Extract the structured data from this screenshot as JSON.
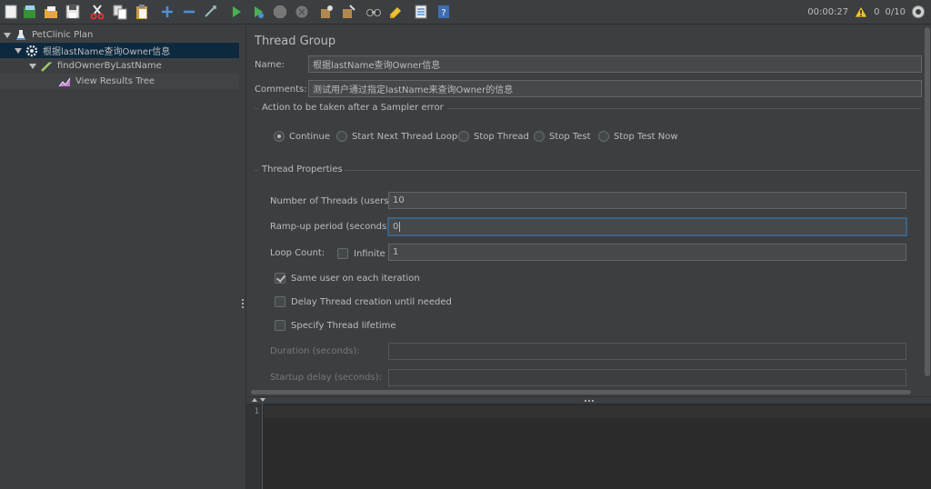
{
  "toolbar": {
    "buttons": [
      {
        "name": "new-icon"
      },
      {
        "name": "templates-icon"
      },
      {
        "name": "open-icon"
      },
      {
        "name": "save-icon"
      },
      {
        "name": "cut-icon"
      },
      {
        "name": "copy-icon"
      },
      {
        "name": "paste-icon"
      },
      {
        "name": "expand-icon"
      },
      {
        "name": "collapse-icon"
      },
      {
        "name": "toggle-icon"
      },
      {
        "name": "start-icon"
      },
      {
        "name": "start-no-pauses-icon"
      },
      {
        "name": "stop-icon"
      },
      {
        "name": "shutdown-icon"
      },
      {
        "name": "clear-icon"
      },
      {
        "name": "clear-all-icon"
      },
      {
        "name": "search-icon"
      },
      {
        "name": "reset-search-icon"
      },
      {
        "name": "function-helper-icon"
      },
      {
        "name": "help-icon"
      }
    ],
    "status": {
      "elapsed": "00:00:27",
      "warnings": "0",
      "threads": "0/10"
    }
  },
  "tree": {
    "items": [
      {
        "label": "PetClinic Plan",
        "level": 0,
        "icon": "test-plan-icon",
        "expanded": true
      },
      {
        "label": "根据lastName查询Owner信息",
        "level": 1,
        "icon": "thread-group-icon",
        "expanded": true,
        "selected": true
      },
      {
        "label": "findOwnerByLastName",
        "level": 2,
        "icon": "http-sampler-icon",
        "expanded": true
      },
      {
        "label": "View Results Tree",
        "level": 3,
        "icon": "listener-icon"
      }
    ]
  },
  "panel": {
    "title": "Thread Group",
    "name_label": "Name:",
    "name_value": "根据lastName查询Owner信息",
    "comments_label": "Comments:",
    "comments_value": "测试用户通过指定lastName来查询Owner的信息",
    "sampler_error": {
      "title": "Action to be taken after a Sampler error",
      "options": [
        "Continue",
        "Start Next Thread Loop",
        "Stop Thread",
        "Stop Test",
        "Stop Test Now"
      ],
      "selected": "Continue"
    },
    "thread_props": {
      "title": "Thread Properties",
      "threads_label": "Number of Threads (users):",
      "threads_value": "10",
      "rampup_label": "Ramp-up period (seconds):",
      "rampup_value": "0",
      "loop_label": "Loop Count:",
      "infinite_label": "Infinite",
      "infinite_checked": false,
      "loop_value": "1",
      "same_user_label": "Same user on each iteration",
      "same_user_checked": true,
      "delay_label": "Delay Thread creation until needed",
      "delay_checked": false,
      "lifetime_label": "Specify Thread lifetime",
      "lifetime_checked": false,
      "duration_label": "Duration (seconds):",
      "duration_value": "",
      "startup_label": "Startup delay (seconds):",
      "startup_value": ""
    }
  },
  "log": {
    "line_numbers": [
      "1"
    ]
  },
  "colors": {
    "background": "#3c3f41",
    "selection": "#0d293e",
    "text": "#bbbbbb",
    "focus_border": "#3d6185",
    "run_green": "#4caf50"
  }
}
